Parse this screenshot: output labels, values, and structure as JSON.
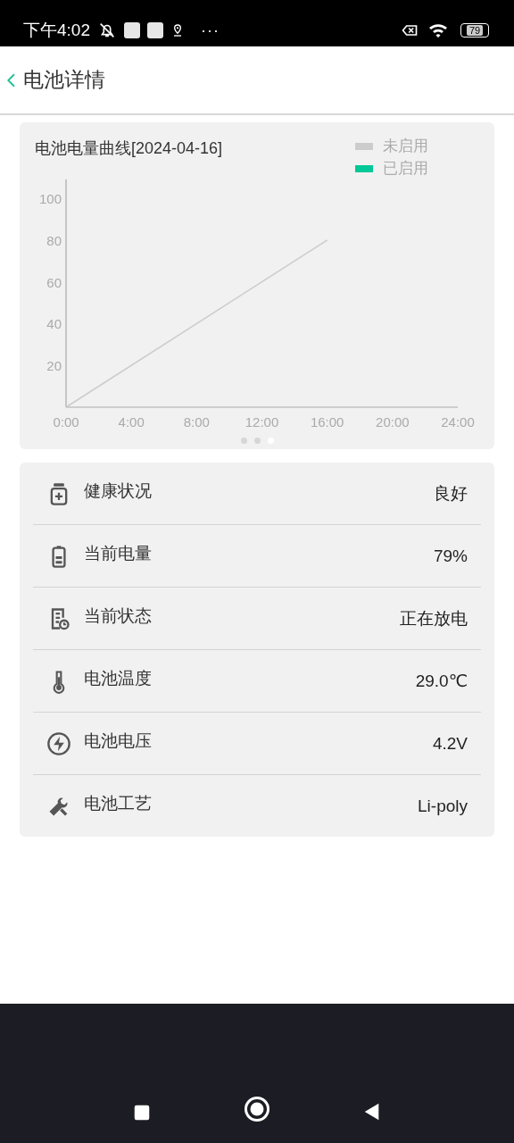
{
  "status_bar": {
    "time": "下午4:02",
    "more": "···",
    "battery_level_text": "79"
  },
  "header": {
    "title": "电池详情"
  },
  "chart_card": {
    "title": "电池电量曲线[2024-04-16]",
    "chart_data": {
      "type": "line",
      "x": [
        0,
        16
      ],
      "xlim": [
        0,
        24
      ],
      "ylim": [
        0,
        109
      ],
      "xticks": [
        {
          "value": 0,
          "label": "0:00"
        },
        {
          "value": 4,
          "label": "4:00"
        },
        {
          "value": 8,
          "label": "8:00"
        },
        {
          "value": 12,
          "label": "12:00"
        },
        {
          "value": 16,
          "label": "16:00"
        },
        {
          "value": 20,
          "label": "20:00"
        },
        {
          "value": 24,
          "label": "24:00"
        }
      ],
      "yticks": [
        20,
        40,
        60,
        80,
        100
      ],
      "series": [
        {
          "name": "未启用",
          "color": "#cccccc",
          "values": [
            0,
            80
          ]
        },
        {
          "name": "已启用",
          "color": "#00c896",
          "values": [
            null,
            null
          ]
        }
      ]
    },
    "pager": [
      {
        "selected": false
      },
      {
        "selected": false
      },
      {
        "selected": true
      }
    ]
  },
  "info_rows": [
    {
      "kind": "health",
      "label": "健康状况",
      "value": "良好"
    },
    {
      "kind": "level",
      "label": "当前电量",
      "value": "79%"
    },
    {
      "kind": "status",
      "label": "当前状态",
      "value": "正在放电"
    },
    {
      "kind": "temperature",
      "label": "电池温度",
      "value": "29.0℃"
    },
    {
      "kind": "voltage",
      "label": "电池电压",
      "value": "4.2V"
    },
    {
      "kind": "technology",
      "label": "电池工艺",
      "value": "Li-poly"
    }
  ]
}
